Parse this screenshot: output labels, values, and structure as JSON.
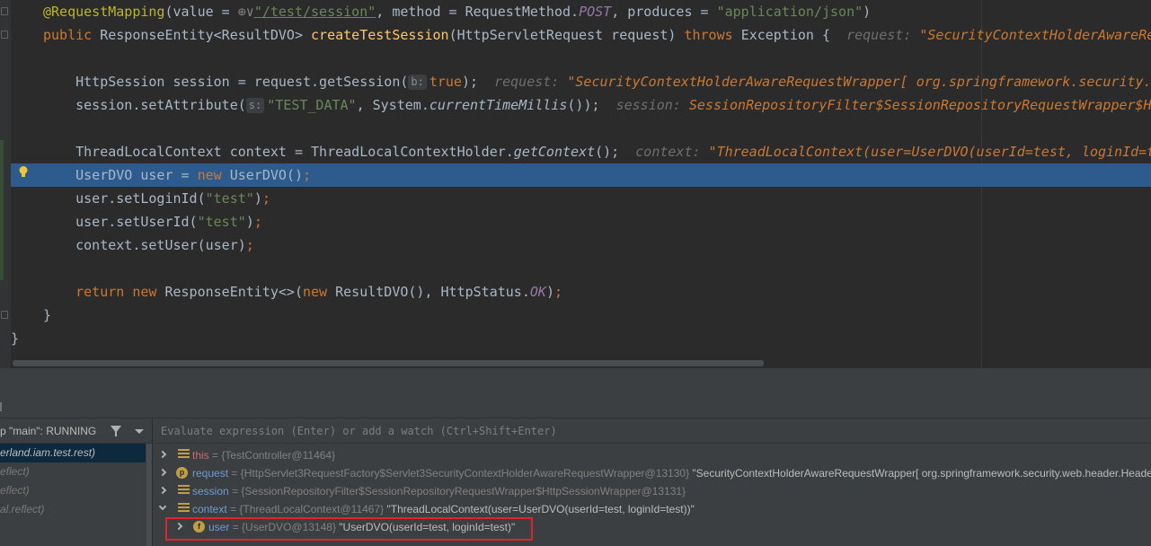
{
  "editor": {
    "code": [
      [
        {
          "t": "@RequestMapping",
          "c": "a"
        },
        {
          "t": "(value = "
        },
        {
          "t": "⊕∨",
          "c": "vtype"
        },
        {
          "t": "\"/test/session\"",
          "c": "lnk"
        },
        {
          "t": ", method = RequestMethod."
        },
        {
          "t": "POST",
          "c": "c"
        },
        {
          "t": ", produces = "
        },
        {
          "t": "\"application/json\"",
          "c": "s"
        },
        {
          "t": ")"
        }
      ],
      [
        {
          "t": "public ",
          "c": "k"
        },
        {
          "t": "ResponseEntity<ResultDVO> "
        },
        {
          "t": "createTestSession",
          "c": "f"
        },
        {
          "t": "(HttpServletRequest request) "
        },
        {
          "t": "throws ",
          "c": "k"
        },
        {
          "t": "Exception {  "
        },
        {
          "t": "request: ",
          "c": "ival"
        },
        {
          "t": "\"SecurityContextHolderAwareRequ",
          "c": "ivv"
        }
      ],
      [],
      [
        {
          "t": "    HttpSession session = request.getSession("
        },
        {
          "t": "b:",
          "c": "hint"
        },
        {
          "t": "true",
          "c": "k"
        },
        {
          "t": ");  "
        },
        {
          "t": "request: ",
          "c": "ival"
        },
        {
          "t": "\"SecurityContextHolderAwareRequestWrapper[ org.springframework.security.",
          "c": "ivv"
        }
      ],
      [
        {
          "t": "    session.setAttribute("
        },
        {
          "t": "s:",
          "c": "hint"
        },
        {
          "t": "\"TEST_DATA\"",
          "c": "s"
        },
        {
          "t": ", System."
        },
        {
          "t": "currentTimeMillis",
          "c": "it"
        },
        {
          "t": "());  "
        },
        {
          "t": "session: ",
          "c": "ival"
        },
        {
          "t": "SessionRepositoryFilter$SessionRepositoryRequestWrapper$H",
          "c": "ivv"
        }
      ],
      [],
      [
        {
          "t": "    ThreadLocalContext context = ThreadLocalContextHolder."
        },
        {
          "t": "getContext",
          "c": "it"
        },
        {
          "t": "();  "
        },
        {
          "t": "context: ",
          "c": "ival"
        },
        {
          "t": "\"ThreadLocalContext(user=UserDVO(userId=test, loginId=t",
          "c": "ivv"
        }
      ],
      [
        {
          "t": "    UserDVO user = "
        },
        {
          "t": "new ",
          "c": "k"
        },
        {
          "t": "UserDVO()"
        },
        {
          "t": ";",
          "c": "k"
        }
      ],
      [
        {
          "t": "    user.setLoginId("
        },
        {
          "t": "\"test\"",
          "c": "s"
        },
        {
          "t": ")"
        },
        {
          "t": ";",
          "c": "k"
        }
      ],
      [
        {
          "t": "    user.setUserId("
        },
        {
          "t": "\"test\"",
          "c": "s"
        },
        {
          "t": ")"
        },
        {
          "t": ";",
          "c": "k"
        }
      ],
      [
        {
          "t": "    context.setUser(user)"
        },
        {
          "t": ";",
          "c": "k"
        }
      ],
      [],
      [
        {
          "t": "    return new ",
          "c": "k"
        },
        {
          "t": "ResponseEntity<>("
        },
        {
          "t": "new ",
          "c": "k"
        },
        {
          "t": "ResultDVO(), HttpStatus."
        },
        {
          "t": "OK",
          "c": "c"
        },
        {
          "t": ")"
        },
        {
          "t": ";",
          "c": "k"
        }
      ],
      [
        {
          "t": "}"
        }
      ],
      [
        {
          "t": "}"
        }
      ]
    ]
  },
  "debugger": {
    "thread_label": "p \"main\": RUNNING",
    "frames": [
      "erland.iam.test.rest)",
      "eflect)",
      "eflect)",
      "al.reflect)"
    ],
    "watch_placeholder": "Evaluate expression (Enter) or add a watch (Ctrl+Shift+Enter)",
    "variables": [
      {
        "name": "this",
        "type": "{TestController@11464}",
        "value": ""
      },
      {
        "name": "request",
        "type": "{HttpServlet3RequestFactory$Servlet3SecurityContextHolderAwareRequestWrapper@13130}",
        "value": "\"SecurityContextHolderAwareRequestWrapper[ org.springframework.security.web.header.Header"
      },
      {
        "name": "session",
        "type": "{SessionRepositoryFilter$SessionRepositoryRequestWrapper$HttpSessionWrapper@13131}",
        "value": ""
      },
      {
        "name": "context",
        "type": "{ThreadLocalContext@11467}",
        "value": "\"ThreadLocalContext(user=UserDVO(userId=test, loginId=test))\""
      },
      {
        "name": "user",
        "type": "{UserDVO@13148}",
        "value": "\"UserDVO(userId=test, loginId=test)\""
      }
    ]
  }
}
